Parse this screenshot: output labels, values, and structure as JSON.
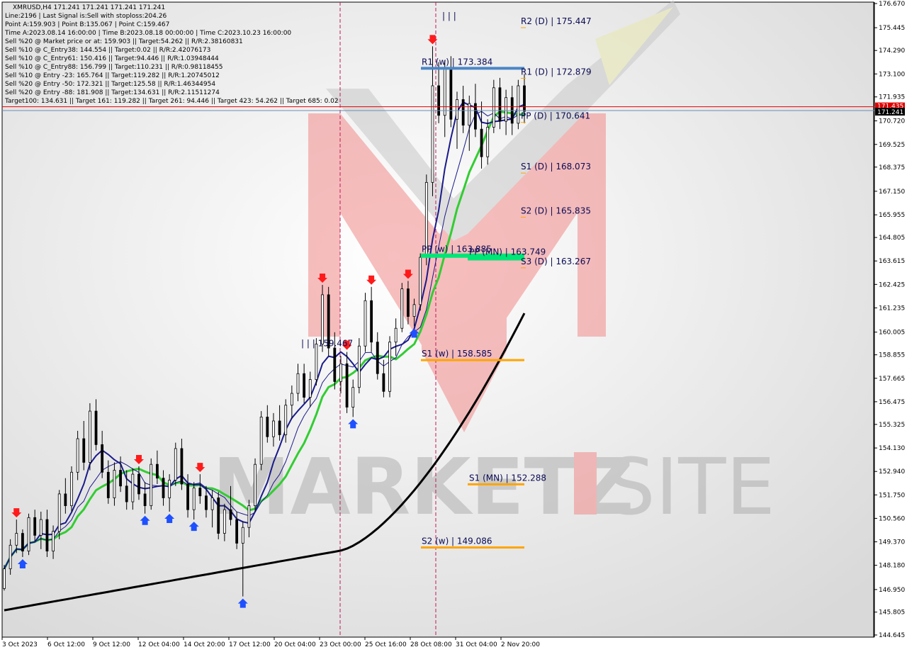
{
  "header": {
    "symbol_line": "XMRUSD,H4  171.241 171.241 171.241 171.241",
    "lines": [
      "Line:2196 | Last Signal is:Sell with stoploss:204.26",
      "Point A:159.903 | Point B:135.067 | Point C:159.467",
      "Time A:2023.08.14 16:00:00 | Time B:2023.08.18 00:00:00 | Time C:2023.10.23 16:00:00",
      "Sell %20 @ Market price or at: 159.903 || Target:54.262 || R/R:2.38160831",
      "Sell %10 @ C_Entry38: 144.554 || Target:0.02 || R/R:2.42076173",
      "Sell %10 @ C_Entry61: 150.416 || Target:94.446 || R/R:1.03948444",
      "Sell %10 @ C_Entry88: 156.799 || Target:110.231 || R/R:0.98118455",
      "Sell %10 @ Entry -23: 165.764 || Target:119.282 || R/R:1.20745012",
      "Sell %20 @ Entry -50: 172.321 || Target:125.58 || R/R:1.46344954",
      "Sell %20 @ Entry -88: 181.908 || Target:134.631 || R/R:2.11511274",
      "Target100: 134.631 || Target 161: 119.282 || Target 261: 94.446 || Target 423: 54.262 || Target 685: 0.02"
    ]
  },
  "watermark": {
    "text_a": "MARKETZ",
    "text_b": "SITE"
  },
  "colors": {
    "bull_bear": "#000000",
    "ma_fast": "#1a1a8c",
    "ma_mid": "#32cd32",
    "ma_slow": "#000000",
    "arrow_up": "#1e50ff",
    "arrow_down": "#ff1a1a",
    "pivot_blue": "#4a86c5",
    "pivot_green": "#00e676",
    "pivot_orange": "#ffa500",
    "price_line": "#e00000",
    "price_tag_bg": "#000000",
    "vline": "#c2185b"
  },
  "price_tags": {
    "top": "171.435",
    "bottom": "171.241"
  },
  "chart_data": {
    "type": "candlestick",
    "y_range": [
      144.645,
      176.67
    ],
    "y_ticks": [
      "176.670",
      "175.445",
      "174.290",
      "173.100",
      "171.935",
      "170.720",
      "169.525",
      "168.375",
      "167.150",
      "165.955",
      "164.805",
      "163.615",
      "162.425",
      "161.235",
      "160.005",
      "158.855",
      "157.665",
      "156.475",
      "155.325",
      "154.130",
      "152.940",
      "151.750",
      "150.560",
      "149.370",
      "148.180",
      "146.950",
      "145.805",
      "144.645"
    ],
    "x_labels": [
      "3 Oct 2023",
      "6 Oct 12:00",
      "9 Oct 12:00",
      "12 Oct 04:00",
      "14 Oct 20:00",
      "17 Oct 12:00",
      "20 Oct 04:00",
      "23 Oct 00:00",
      "25 Oct 16:00",
      "28 Oct 08:00",
      "31 Oct 04:00",
      "2 Nov 20:00"
    ],
    "last_price": 171.241,
    "pivot_levels": [
      {
        "label": "R2 (D) | 175.447",
        "value": 175.447,
        "style": "tick"
      },
      {
        "label": "R1 (w) | 173.384",
        "value": 173.384,
        "style": "blue"
      },
      {
        "label": "R1 (D) | 172.879",
        "value": 172.879,
        "style": "tick"
      },
      {
        "label": "PP (D) | 170.641",
        "value": 170.641,
        "style": "tick"
      },
      {
        "label": "S1 (D) | 168.073",
        "value": 168.073,
        "style": "tick"
      },
      {
        "label": "S2 (D) | 165.835",
        "value": 165.835,
        "style": "tick"
      },
      {
        "label": "PP (w) | 163.885",
        "value": 163.885,
        "style": "green"
      },
      {
        "label": "PP (MN) | 163.749",
        "value": 163.749,
        "style": "green"
      },
      {
        "label": "S3 (D) | 163.267",
        "value": 163.267,
        "style": "tick"
      },
      {
        "label": "S1 (w) | 158.585",
        "value": 158.585,
        "style": "orange"
      },
      {
        "label": "S1 (MN) | 152.288",
        "value": 152.288,
        "style": "orange"
      },
      {
        "label": "S2 (w) | 149.086",
        "value": 149.086,
        "style": "orange"
      }
    ],
    "annotation": {
      "label": "| | | 159.467",
      "value": 159.467
    },
    "top_marks": {
      "label": "| | |",
      "value": 175.9
    },
    "candles": [
      [
        147.0,
        148.2,
        146.9,
        148.0
      ],
      [
        148.0,
        149.5,
        147.7,
        149.2
      ],
      [
        149.2,
        150.5,
        148.8,
        149.8
      ],
      [
        149.8,
        150.0,
        148.6,
        148.9
      ],
      [
        148.9,
        150.8,
        148.7,
        150.6
      ],
      [
        150.6,
        151.0,
        149.4,
        149.7
      ],
      [
        149.7,
        150.9,
        149.0,
        150.5
      ],
      [
        150.5,
        151.0,
        148.6,
        148.9
      ],
      [
        148.9,
        150.2,
        148.5,
        149.9
      ],
      [
        149.9,
        152.0,
        149.5,
        151.8
      ],
      [
        151.8,
        152.6,
        150.8,
        151.2
      ],
      [
        151.2,
        153.2,
        150.9,
        152.9
      ],
      [
        152.9,
        155.0,
        152.5,
        154.6
      ],
      [
        154.6,
        155.5,
        153.0,
        153.4
      ],
      [
        153.4,
        156.4,
        153.0,
        156.0
      ],
      [
        156.0,
        156.6,
        154.0,
        154.3
      ],
      [
        154.3,
        155.0,
        152.6,
        152.9
      ],
      [
        152.9,
        153.5,
        151.3,
        151.6
      ],
      [
        151.6,
        153.4,
        151.2,
        153.0
      ],
      [
        153.0,
        153.7,
        151.9,
        152.2
      ],
      [
        152.2,
        153.0,
        151.0,
        151.4
      ],
      [
        151.4,
        153.1,
        151.0,
        152.8
      ],
      [
        152.8,
        153.2,
        151.5,
        151.8
      ],
      [
        151.8,
        152.4,
        150.8,
        151.2
      ],
      [
        151.2,
        153.6,
        151.0,
        153.3
      ],
      [
        153.3,
        154.0,
        152.3,
        152.6
      ],
      [
        152.6,
        153.0,
        151.2,
        151.6
      ],
      [
        151.6,
        152.8,
        150.9,
        152.5
      ],
      [
        152.5,
        154.4,
        152.2,
        154.1
      ],
      [
        154.1,
        154.6,
        152.0,
        152.3
      ],
      [
        152.3,
        152.8,
        150.6,
        151.0
      ],
      [
        151.0,
        152.4,
        150.5,
        152.1
      ],
      [
        152.1,
        152.8,
        151.3,
        151.7
      ],
      [
        151.7,
        152.2,
        150.6,
        151.0
      ],
      [
        151.0,
        152.0,
        150.1,
        151.6
      ],
      [
        151.6,
        151.9,
        149.5,
        149.8
      ],
      [
        149.8,
        151.3,
        149.4,
        151.0
      ],
      [
        151.0,
        152.2,
        150.2,
        150.5
      ],
      [
        150.5,
        150.9,
        149.0,
        149.3
      ],
      [
        149.3,
        150.4,
        146.6,
        150.1
      ],
      [
        150.1,
        151.5,
        149.6,
        151.2
      ],
      [
        151.2,
        153.6,
        150.9,
        153.3
      ],
      [
        153.3,
        156.0,
        153.0,
        155.7
      ],
      [
        155.7,
        156.3,
        154.4,
        154.7
      ],
      [
        154.7,
        155.9,
        154.2,
        155.5
      ],
      [
        155.5,
        156.3,
        154.5,
        154.8
      ],
      [
        154.8,
        156.6,
        154.4,
        156.3
      ],
      [
        156.3,
        157.3,
        155.6,
        156.9
      ],
      [
        156.9,
        158.4,
        156.5,
        157.9
      ],
      [
        157.9,
        158.4,
        156.4,
        156.7
      ],
      [
        156.7,
        158.0,
        156.2,
        157.6
      ],
      [
        157.6,
        159.7,
        157.3,
        159.4
      ],
      [
        159.4,
        162.4,
        159.0,
        161.9
      ],
      [
        161.9,
        162.3,
        158.8,
        159.2
      ],
      [
        159.2,
        160.0,
        157.1,
        157.5
      ],
      [
        157.5,
        158.8,
        156.9,
        158.4
      ],
      [
        158.4,
        159.0,
        155.9,
        156.2
      ],
      [
        156.2,
        157.6,
        155.7,
        157.2
      ],
      [
        157.2,
        159.7,
        156.9,
        159.3
      ],
      [
        159.3,
        162.0,
        159.0,
        161.6
      ],
      [
        161.6,
        162.3,
        159.0,
        159.5
      ],
      [
        159.5,
        160.0,
        157.6,
        157.9
      ],
      [
        157.9,
        158.6,
        156.7,
        157.0
      ],
      [
        157.0,
        159.8,
        156.7,
        159.5
      ],
      [
        159.5,
        160.7,
        158.8,
        160.2
      ],
      [
        160.2,
        162.5,
        160.0,
        162.2
      ],
      [
        162.2,
        162.6,
        160.4,
        160.8
      ],
      [
        160.8,
        161.7,
        160.3,
        161.4
      ],
      [
        161.4,
        164.0,
        161.1,
        163.8
      ],
      [
        163.8,
        168.0,
        163.4,
        167.6
      ],
      [
        167.6,
        174.5,
        166.9,
        172.5
      ],
      [
        172.5,
        173.7,
        170.6,
        171.0
      ],
      [
        171.0,
        173.8,
        169.9,
        173.4
      ],
      [
        173.4,
        174.0,
        170.4,
        170.8
      ],
      [
        170.8,
        172.2,
        169.3,
        171.8
      ],
      [
        171.8,
        172.5,
        170.1,
        170.5
      ],
      [
        170.5,
        172.0,
        169.2,
        171.6
      ],
      [
        171.6,
        172.6,
        169.9,
        170.3
      ],
      [
        170.3,
        171.7,
        168.3,
        168.9
      ],
      [
        168.9,
        170.8,
        168.5,
        170.4
      ],
      [
        170.4,
        172.8,
        170.1,
        172.4
      ],
      [
        172.4,
        172.9,
        170.3,
        170.7
      ],
      [
        170.7,
        172.3,
        170.0,
        171.9
      ],
      [
        171.9,
        172.5,
        170.0,
        170.6
      ],
      [
        170.6,
        172.8,
        170.3,
        172.5
      ],
      [
        172.5,
        173.1,
        170.6,
        171.2
      ]
    ]
  }
}
